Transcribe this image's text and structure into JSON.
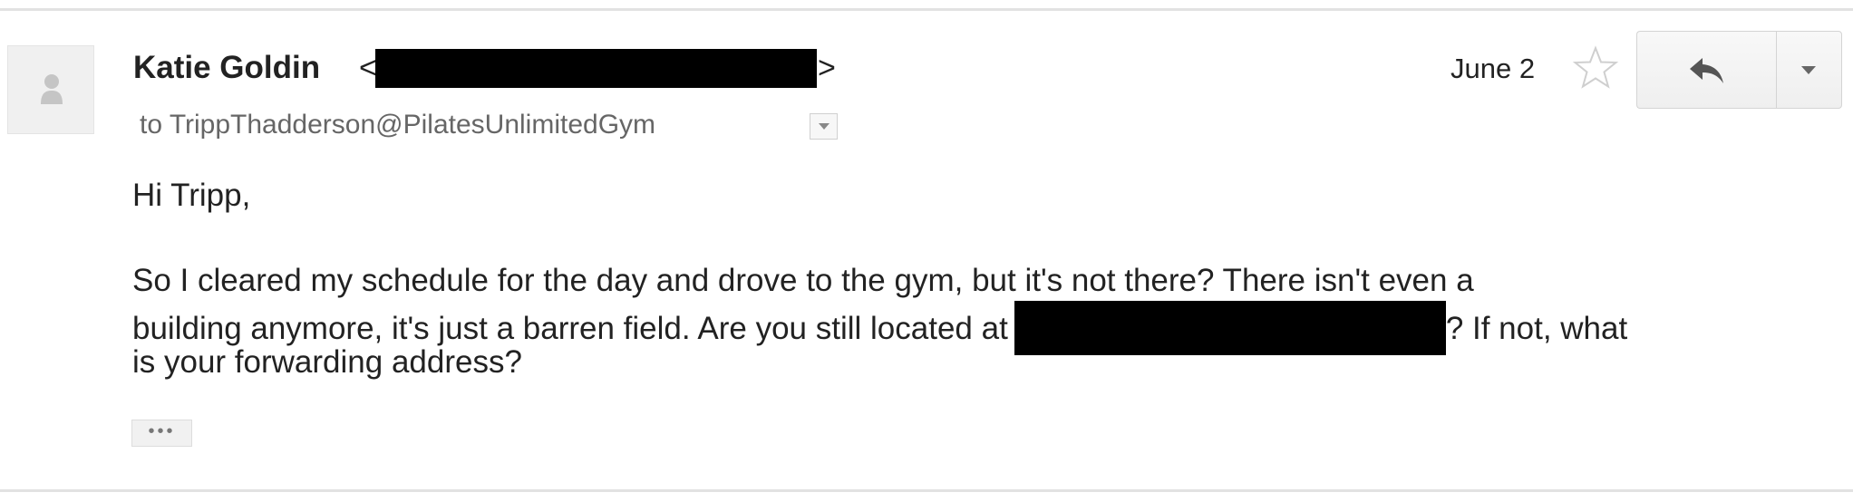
{
  "email": {
    "sender_name": "Katie Goldin",
    "sender_open_bracket": "<",
    "sender_close_bracket": ">",
    "recipient": "to TrippThadderson@PilatesUnlimitedGym",
    "date": "June 2",
    "body": {
      "greeting": "Hi Tripp,",
      "line1": "So I cleared my schedule for the day and drove to the gym, but it's not there? There isn't even a",
      "line2_before": "building anymore, it's just a barren field. Are you still located at",
      "line2_after": "? If not, what",
      "line3": "is your forwarding address?"
    },
    "trimmed_content_label": "•••"
  },
  "icons": {
    "avatar": "person-icon",
    "details": "chevron-down-icon",
    "star": "star-icon",
    "reply": "reply-arrow-icon",
    "more": "caret-down-icon"
  },
  "colors": {
    "text": "#222222",
    "secondary_text": "#666666",
    "redaction": "#000000",
    "divider": "#e2e2e2",
    "button_border": "#d4d4d4"
  }
}
